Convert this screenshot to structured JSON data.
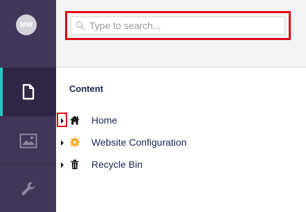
{
  "user": {
    "initials": "MW"
  },
  "rail": {
    "items": [
      {
        "id": "content",
        "icon": "document-icon",
        "active": true
      },
      {
        "id": "media",
        "icon": "image-icon",
        "active": false
      },
      {
        "id": "settings",
        "icon": "wrench-icon",
        "active": false
      }
    ]
  },
  "search": {
    "placeholder": "Type to search..."
  },
  "tree": {
    "title": "Content",
    "nodes": [
      {
        "label": "Home",
        "icon": "home-icon"
      },
      {
        "label": "Website Configuration",
        "icon": "gear-icon"
      },
      {
        "label": "Recycle Bin",
        "icon": "trash-icon"
      }
    ]
  },
  "colors": {
    "rail": "#413659",
    "rail_active": "#2f2545",
    "accent": "#2bc3c4",
    "highlight": "#e30613",
    "gear": "#f5a623",
    "text": "#1b264f"
  }
}
